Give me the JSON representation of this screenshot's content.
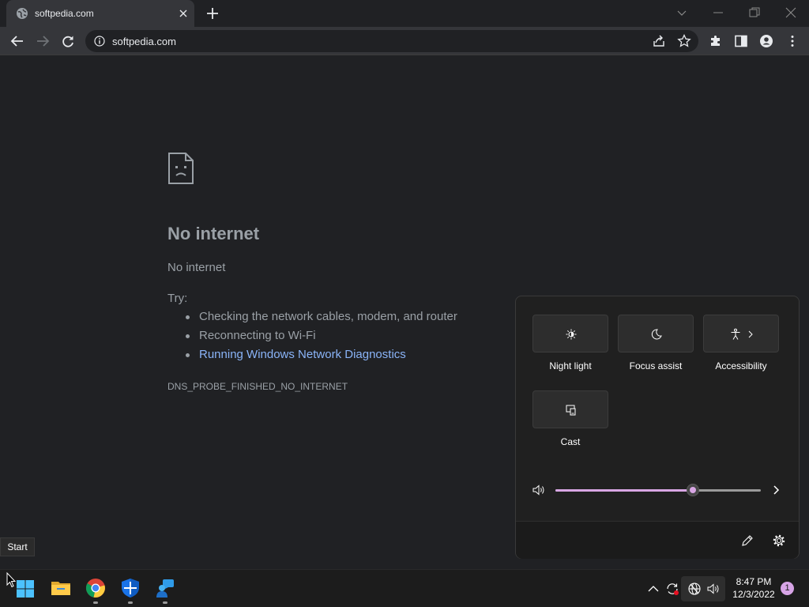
{
  "browser": {
    "tab": {
      "title": "softpedia.com"
    },
    "url": "softpedia.com"
  },
  "page": {
    "title": "No internet",
    "subtitle": "No internet",
    "try_label": "Try:",
    "suggestions": [
      "Checking the network cables, modem, and router",
      "Reconnecting to Wi-Fi",
      "Running Windows Network Diagnostics"
    ],
    "error_code": "DNS_PROBE_FINISHED_NO_INTERNET"
  },
  "quick_settings": {
    "tiles": [
      {
        "label": "Night light",
        "icon": "brightness-icon"
      },
      {
        "label": "Focus assist",
        "icon": "moon-icon"
      },
      {
        "label": "Accessibility",
        "icon": "accessibility-icon"
      },
      {
        "label": "Cast",
        "icon": "cast-icon"
      }
    ],
    "volume_level": 0.67,
    "accent_color": "#d8a6e4"
  },
  "tooltip": {
    "text": "Start"
  },
  "taskbar": {
    "clock": {
      "time": "8:47 PM",
      "date": "12/3/2022"
    },
    "notification_count": "1"
  }
}
